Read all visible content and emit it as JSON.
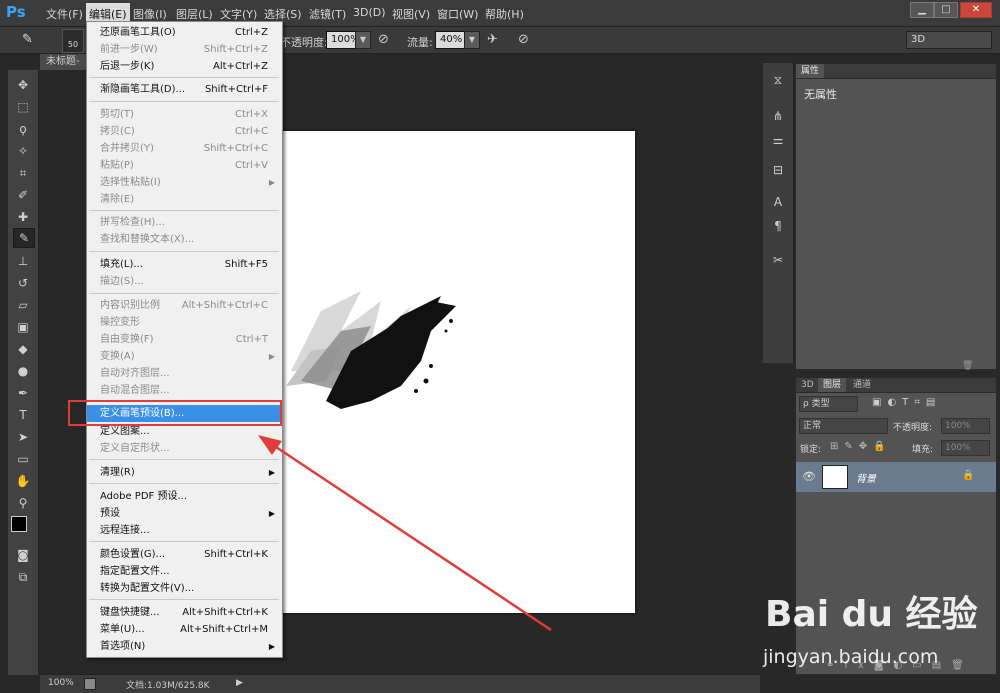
{
  "app": {
    "logo": "Ps",
    "doc_tab": "未标题-",
    "zoom": "100%",
    "doc_info": "文档:1.03M/625.8K",
    "workspace": "3D"
  },
  "menubar": {
    "items": [
      "文件(F)",
      "编辑(E)",
      "图像(I)",
      "图层(L)",
      "文字(Y)",
      "选择(S)",
      "滤镜(T)",
      "3D(D)",
      "视图(V)",
      "窗口(W)",
      "帮助(H)"
    ],
    "active_index": 1,
    "window_controls": [
      "▁",
      "□",
      "✕"
    ]
  },
  "options": {
    "brush_size": "50",
    "opacity_label": "不透明度:",
    "opacity_value": "100%",
    "flow_label": "流量:",
    "flow_value": "40%"
  },
  "edit_menu": {
    "items": [
      {
        "label": "还原画笔工具(O)",
        "shortcut": "Ctrl+Z",
        "disabled": false
      },
      {
        "label": "前进一步(W)",
        "shortcut": "Shift+Ctrl+Z",
        "disabled": true
      },
      {
        "label": "后退一步(K)",
        "shortcut": "Alt+Ctrl+Z",
        "disabled": false
      },
      {
        "label": "渐隐画笔工具(D)...",
        "shortcut": "Shift+Ctrl+F",
        "disabled": false
      },
      {
        "label": "剪切(T)",
        "shortcut": "Ctrl+X",
        "disabled": true
      },
      {
        "label": "拷贝(C)",
        "shortcut": "Ctrl+C",
        "disabled": true
      },
      {
        "label": "合并拷贝(Y)",
        "shortcut": "Shift+Ctrl+C",
        "disabled": true
      },
      {
        "label": "粘贴(P)",
        "shortcut": "Ctrl+V",
        "disabled": true
      },
      {
        "label": "选择性粘贴(I)",
        "shortcut": "",
        "disabled": true,
        "submenu": true
      },
      {
        "label": "清除(E)",
        "shortcut": "",
        "disabled": true
      },
      {
        "label": "拼写检查(H)...",
        "shortcut": "",
        "disabled": true
      },
      {
        "label": "查找和替换文本(X)...",
        "shortcut": "",
        "disabled": true
      },
      {
        "label": "填充(L)...",
        "shortcut": "Shift+F5",
        "disabled": false
      },
      {
        "label": "描边(S)...",
        "shortcut": "",
        "disabled": true
      },
      {
        "label": "内容识别比例",
        "shortcut": "Alt+Shift+Ctrl+C",
        "disabled": true
      },
      {
        "label": "操控变形",
        "shortcut": "",
        "disabled": true
      },
      {
        "label": "自由变换(F)",
        "shortcut": "Ctrl+T",
        "disabled": true
      },
      {
        "label": "变换(A)",
        "shortcut": "",
        "disabled": true,
        "submenu": true
      },
      {
        "label": "自动对齐图层...",
        "shortcut": "",
        "disabled": true
      },
      {
        "label": "自动混合图层...",
        "shortcut": "",
        "disabled": true
      },
      {
        "label": "定义画笔预设(B)...",
        "shortcut": "",
        "disabled": false,
        "highlighted": true
      },
      {
        "label": "定义图案...",
        "shortcut": "",
        "disabled": false
      },
      {
        "label": "定义自定形状...",
        "shortcut": "",
        "disabled": true
      },
      {
        "label": "清理(R)",
        "shortcut": "",
        "disabled": false,
        "submenu": true
      },
      {
        "label": "Adobe PDF 预设...",
        "shortcut": "",
        "disabled": false
      },
      {
        "label": "预设",
        "shortcut": "",
        "disabled": false,
        "submenu": true
      },
      {
        "label": "远程连接...",
        "shortcut": "",
        "disabled": false
      },
      {
        "label": "颜色设置(G)...",
        "shortcut": "Shift+Ctrl+K",
        "disabled": false
      },
      {
        "label": "指定配置文件...",
        "shortcut": "",
        "disabled": false
      },
      {
        "label": "转换为配置文件(V)...",
        "shortcut": "",
        "disabled": false
      },
      {
        "label": "键盘快捷键...",
        "shortcut": "Alt+Shift+Ctrl+K",
        "disabled": false
      },
      {
        "label": "菜单(U)...",
        "shortcut": "Alt+Shift+Ctrl+M",
        "disabled": false
      },
      {
        "label": "首选项(N)",
        "shortcut": "",
        "disabled": false,
        "submenu": true
      }
    ]
  },
  "properties_panel": {
    "tab": "属性",
    "content": "无属性"
  },
  "layers_panel": {
    "tabs": [
      "3D",
      "图层",
      "通道"
    ],
    "active_tab": 1,
    "kind_filter": "ρ 类型",
    "blend_mode": "正常",
    "opacity_label": "不透明度:",
    "opacity_value": "100%",
    "lock_label": "锁定:",
    "fill_label": "填充:",
    "fill_value": "100%",
    "layer_name": "背景"
  },
  "watermark": {
    "brand": "Bai du 经验",
    "url": "jingyan.baidu.com"
  },
  "colors": {
    "highlight": "#3a8fe7",
    "annotation": "#e23b3b",
    "panel": "#535353",
    "layer_selected": "#6b7b8f"
  }
}
